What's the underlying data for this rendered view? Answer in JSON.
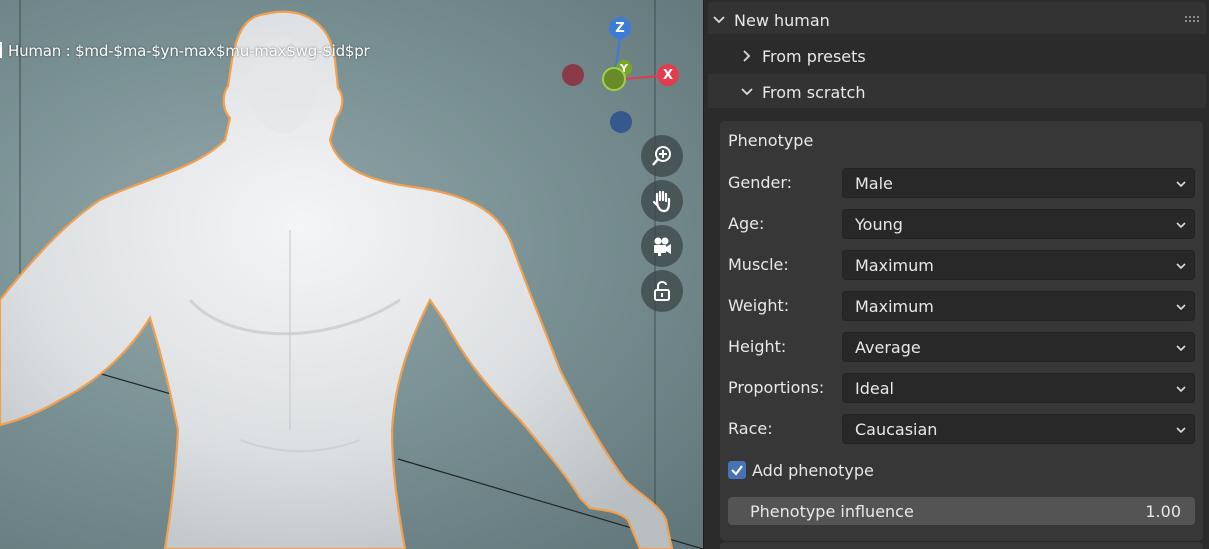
{
  "viewport": {
    "object_label": "Human : $md-$ma-$yn-max$mu-max$wg-$id$pr",
    "gizmo": {
      "z_label": "Z",
      "y_label": "Y",
      "x_label": "X"
    },
    "nav_icons": [
      "zoom-icon",
      "hand-pan-icon",
      "camera-icon",
      "lock-icon"
    ],
    "colors": {
      "x_axis": "#e23d4e",
      "y_axis": "#7ba625",
      "z_axis": "#3d7bd9",
      "outline": "#f0a050"
    }
  },
  "panel": {
    "title": "New human",
    "sections": [
      {
        "label": "From presets",
        "expanded": false
      },
      {
        "label": "From scratch",
        "expanded": true
      }
    ],
    "phenotype": {
      "title": "Phenotype",
      "fields": [
        {
          "label": "Gender:",
          "value": "Male"
        },
        {
          "label": "Age:",
          "value": "Young"
        },
        {
          "label": "Muscle:",
          "value": "Maximum"
        },
        {
          "label": "Weight:",
          "value": "Maximum"
        },
        {
          "label": "Height:",
          "value": "Average"
        },
        {
          "label": "Proportions:",
          "value": "Ideal"
        },
        {
          "label": "Race:",
          "value": "Caucasian"
        }
      ],
      "add_phenotype": {
        "label": "Add phenotype",
        "checked": true
      },
      "influence": {
        "label": "Phenotype influence",
        "value": "1.00"
      }
    }
  }
}
